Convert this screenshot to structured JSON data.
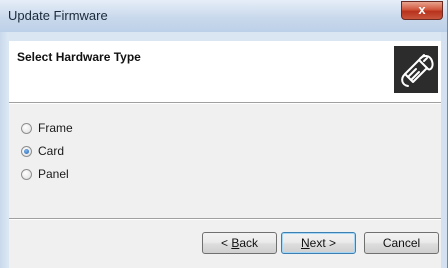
{
  "window": {
    "title": "Update Firmware",
    "close_label": "x"
  },
  "header": {
    "title": "Select Hardware Type",
    "icon": "cable-plug-icon"
  },
  "options": [
    {
      "label": "Frame",
      "checked": false
    },
    {
      "label": "Card",
      "checked": true
    },
    {
      "label": "Panel",
      "checked": false
    }
  ],
  "buttons": {
    "back": {
      "prefix": "< ",
      "mnemonic": "B",
      "rest": "ack"
    },
    "next": {
      "mnemonic": "N",
      "rest": "ext >"
    },
    "cancel": "Cancel"
  }
}
